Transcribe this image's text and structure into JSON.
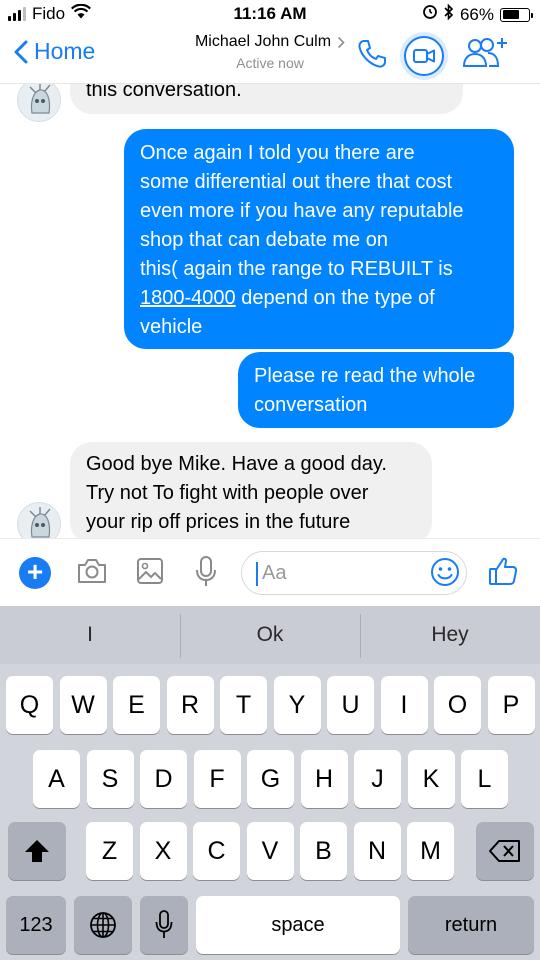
{
  "status_bar": {
    "carrier": "Fido",
    "time": "11:16 AM",
    "battery": "66%",
    "battery_level": 0.66
  },
  "header": {
    "back_label": "Home",
    "contact_name": "Michael John Culm",
    "contact_status": "Active now"
  },
  "messages": [
    {
      "direction": "incoming",
      "text": "this conversation."
    },
    {
      "direction": "outgoing",
      "lines": [
        "Once again I told you there are",
        "some differential out there that cost",
        "even more if you have any reputable",
        "shop that can debate me on",
        "this( again the range to REBUILT is"
      ],
      "link_text": "1800-4000",
      "after_link": " depend on the type of",
      "last_line": "vehicle"
    },
    {
      "direction": "outgoing",
      "lines": [
        "Please re read the whole",
        "conversation"
      ]
    },
    {
      "direction": "incoming",
      "lines": [
        "Good bye Mike. Have a good day.",
        "Try not To fight with people over",
        "your rip off prices in the future"
      ]
    }
  ],
  "composer": {
    "placeholder": "Aa"
  },
  "keyboard": {
    "suggestions": [
      "I",
      "Ok",
      "Hey"
    ],
    "row1": [
      "Q",
      "W",
      "E",
      "R",
      "T",
      "Y",
      "U",
      "I",
      "O",
      "P"
    ],
    "row2": [
      "A",
      "S",
      "D",
      "F",
      "G",
      "H",
      "J",
      "K",
      "L"
    ],
    "row3": [
      "Z",
      "X",
      "C",
      "V",
      "B",
      "N",
      "M"
    ],
    "numbers_label": "123",
    "space_label": "space",
    "return_label": "return"
  },
  "colors": {
    "accent": "#1a7cf5",
    "outgoing_bubble": "#0084ff",
    "incoming_bubble": "#f1f0f0",
    "keyboard_bg": "#d1d4da"
  },
  "icons": [
    "signal-icon",
    "wifi-icon",
    "alarm-icon",
    "bluetooth-icon",
    "battery-icon",
    "back-chevron-icon",
    "phone-icon",
    "video-call-icon",
    "add-people-icon",
    "plus-icon",
    "camera-icon",
    "image-icon",
    "microphone-icon",
    "emoji-icon",
    "thumbs-up-icon",
    "shift-icon",
    "backspace-icon",
    "globe-icon",
    "dictation-icon"
  ]
}
